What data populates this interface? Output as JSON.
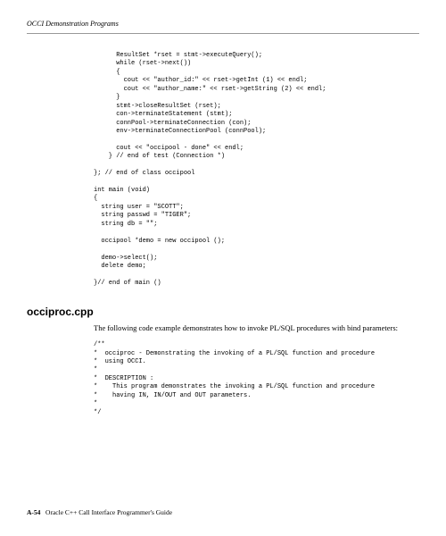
{
  "header": "OCCI Demonstration Programs",
  "code1": "      ResultSet *rset = stmt->executeQuery();\n      while (rset->next())\n      {\n        cout << \"author_id:\" << rset->getInt (1) << endl;\n        cout << \"author_name:\" << rset->getString (2) << endl;\n      }\n      stmt->closeResultSet (rset);\n      con->terminateStatement (stmt);\n      connPool->terminateConnection (con);\n      env->terminateConnectionPool (connPool);\n\n      cout << \"occipool - done\" << endl;\n    } // end of test (Connection *)\n\n}; // end of class occipool\n\nint main (void)\n{\n  string user = \"SCOTT\";\n  string passwd = \"TIGER\";\n  string db = \"\";\n\n  occipool *demo = new occipool ();\n\n  demo->select();\n  delete demo;\n\n}// end of main ()",
  "section_heading": "occiproc.cpp",
  "description": "The following code example demonstrates how to invoke PL/SQL procedures with bind parameters:",
  "code2": "/**\n*  occiproc - Demonstrating the invoking of a PL/SQL function and procedure\n*  using OCCI.\n*\n*  DESCRIPTION :\n*    This program demonstrates the invoking a PL/SQL function and procedure\n*    having IN, IN/OUT and OUT parameters.\n*\n*/",
  "footer_page": "A-54",
  "footer_title": "Oracle C++ Call Interface Programmer's Guide"
}
